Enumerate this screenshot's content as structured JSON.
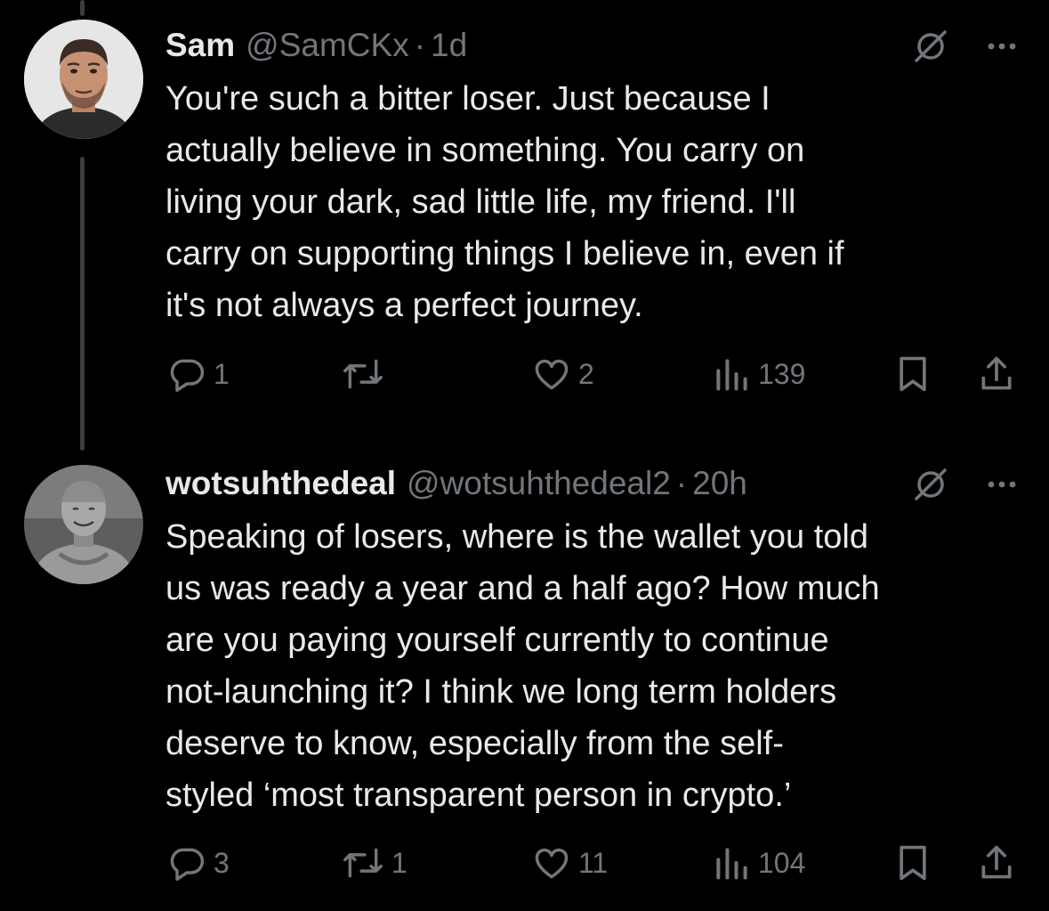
{
  "tweets": [
    {
      "name": "Sam",
      "handle": "@SamCKx",
      "separator": "·",
      "time": "1d",
      "text": "You're such a bitter loser. Just because I\nactually believe in something. You carry on\nliving your dark, sad little life, my friend. I'll\ncarry on supporting things I believe in, even if\nit's not always a perfect journey.",
      "replies": "1",
      "retweets": "",
      "likes": "2",
      "views": "139",
      "icons": {
        "reply": "reply-icon",
        "retweet": "retweet-icon",
        "like": "heart-icon",
        "views": "views-icon",
        "bookmark": "bookmark-icon",
        "share": "share-icon",
        "grok": "grok-icon",
        "more": "more-icon"
      }
    },
    {
      "name": "wotsuhthedeal",
      "handle": "@wotsuhthedeal2",
      "separator": "·",
      "time": "20h",
      "text": "Speaking of losers, where is the wallet you told\nus was ready a year and a half ago? How much\nare you paying yourself currently to continue\nnot-launching it? I think we long term holders\ndeserve to know, especially from the self-\nstyled ‘most transparent person in crypto.’",
      "replies": "3",
      "retweets": "1",
      "likes": "11",
      "views": "104",
      "icons": {
        "reply": "reply-icon",
        "retweet": "retweet-icon",
        "like": "heart-icon",
        "views": "views-icon",
        "bookmark": "bookmark-icon",
        "share": "share-icon",
        "grok": "grok-icon",
        "more": "more-icon"
      }
    }
  ],
  "colors": {
    "background": "#000000",
    "text": "#e7e9ea",
    "secondary": "#71767b",
    "thread_line": "#3a3d41"
  }
}
